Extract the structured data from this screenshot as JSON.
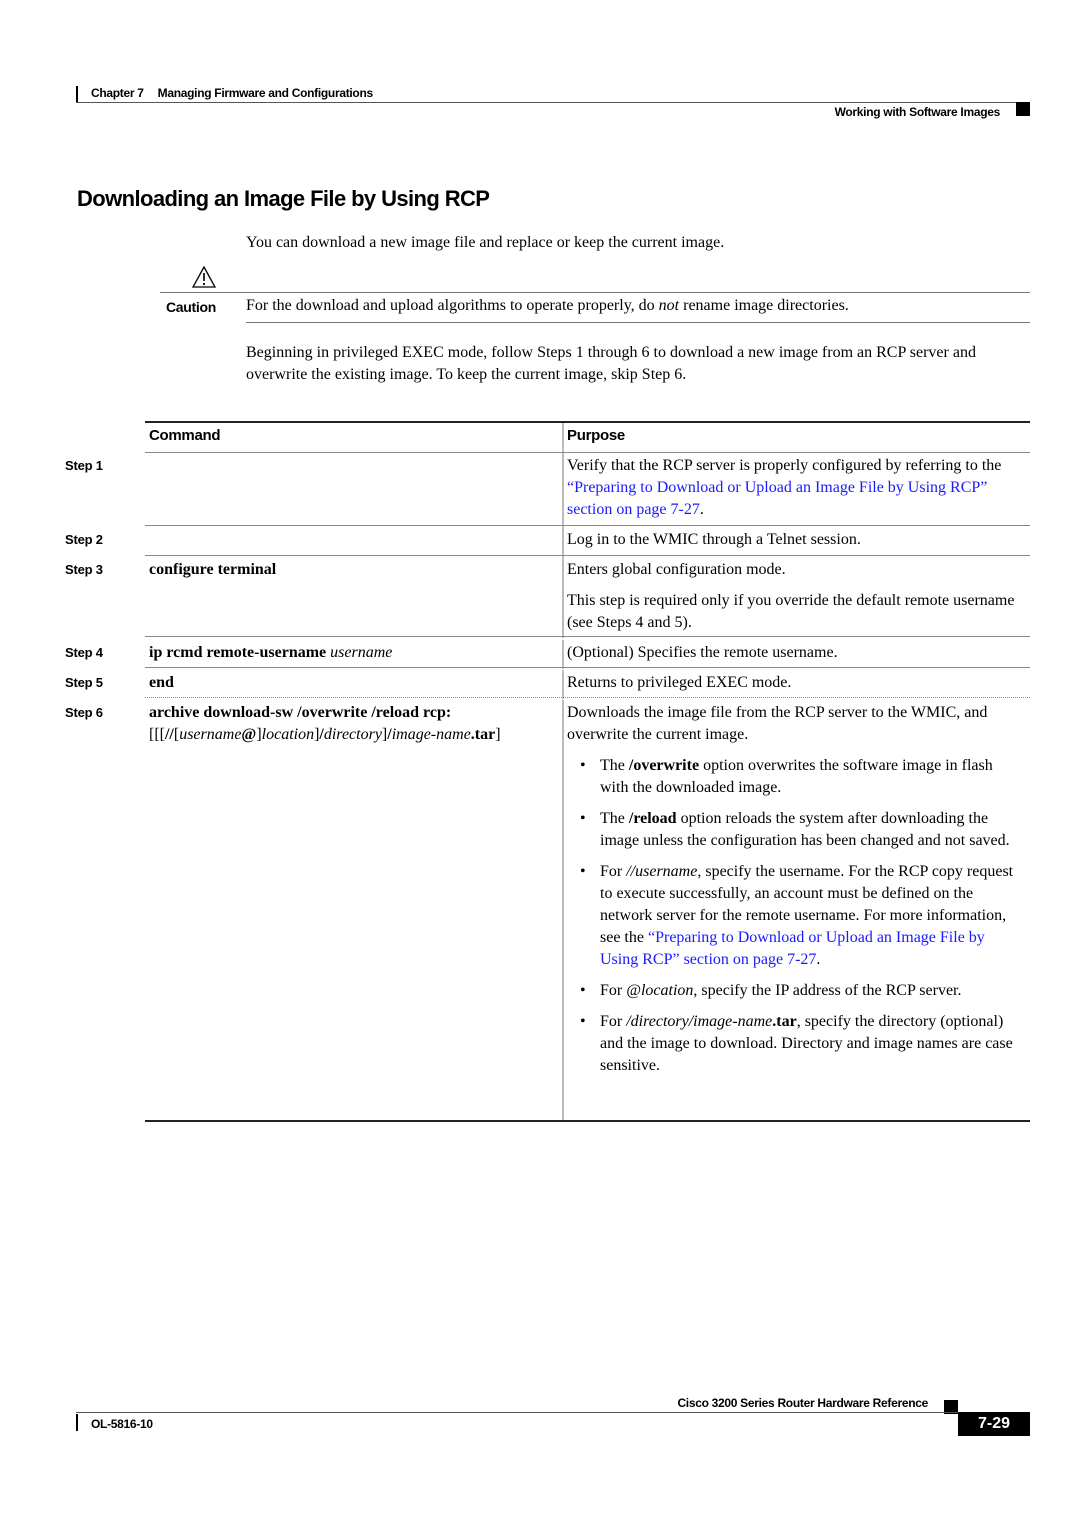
{
  "header": {
    "chapter_label": "Chapter 7",
    "chapter_title": "Managing Firmware and Configurations",
    "section_title": "Working with Software Images"
  },
  "page_title": "Downloading an Image File by Using RCP",
  "intro": "You can download a new image file and replace or keep the current image.",
  "caution": {
    "icon": "warning-triangle-icon",
    "label": "Caution",
    "text": [
      {
        "t": "For the download and upload algorithms to operate properly, do "
      },
      {
        "t": "not",
        "i": true
      },
      {
        "t": " rename image directories."
      }
    ]
  },
  "steps_intro": "Beginning in privileged EXEC mode, follow Steps 1 through 6 to download a new image from an RCP server and overwrite the existing image. To keep the current image, skip Step 6.",
  "table": {
    "columns": [
      "Command",
      "Purpose"
    ],
    "rows": [
      {
        "step": "Step 1",
        "command": [],
        "purpose": [
          {
            "type": "p",
            "runs": [
              {
                "t": "Verify that the RCP server is properly configured by referring to the "
              },
              {
                "t": "“Preparing to Download or Upload an Image File by Using RCP” section on page 7-27",
                "link": true
              },
              {
                "t": "."
              }
            ]
          }
        ]
      },
      {
        "step": "Step 2",
        "command": [],
        "purpose": [
          {
            "type": "p",
            "runs": [
              {
                "t": "Log in to the WMIC through a Telnet session."
              }
            ]
          }
        ]
      },
      {
        "step": "Step 3",
        "command": [
          {
            "t": "configure terminal",
            "b": true
          }
        ],
        "purpose": [
          {
            "type": "p",
            "runs": [
              {
                "t": "Enters global configuration mode."
              }
            ]
          },
          {
            "type": "p",
            "runs": [
              {
                "t": "This step is required only if you override the default remote username (see Steps 4 and 5)."
              }
            ]
          }
        ]
      },
      {
        "step": "Step 4",
        "command": [
          {
            "t": "ip rcmd remote-username ",
            "b": true
          },
          {
            "t": "username",
            "i": true
          }
        ],
        "purpose": [
          {
            "type": "p",
            "runs": [
              {
                "t": "(Optional) Specifies the remote username."
              }
            ]
          }
        ]
      },
      {
        "step": "Step 5",
        "command": [
          {
            "t": "end",
            "b": true
          }
        ],
        "purpose": [
          {
            "type": "p",
            "runs": [
              {
                "t": "Returns to privileged EXEC mode."
              }
            ]
          }
        ]
      },
      {
        "step": "Step 6",
        "command": [
          {
            "t": "archive download-sw /overwrite /reload",
            "b": true
          },
          {
            "t": " "
          },
          {
            "t": "rcp:",
            "b": true
          },
          {
            "t": "[[["
          },
          {
            "t": "//",
            "b": true
          },
          {
            "t": "["
          },
          {
            "t": "username",
            "i": true
          },
          {
            "t": "@",
            "b": true
          },
          {
            "t": "]"
          },
          {
            "t": "location",
            "i": true
          },
          {
            "t": "]"
          },
          {
            "t": "/",
            "b": true
          },
          {
            "t": "directory",
            "i": true
          },
          {
            "t": "]"
          },
          {
            "t": "/",
            "b": true
          },
          {
            "t": "image-name",
            "i": true
          },
          {
            "t": ".tar",
            "b": true
          },
          {
            "t": "]"
          }
        ],
        "purpose": [
          {
            "type": "p",
            "runs": [
              {
                "t": "Downloads the image file from the RCP server to the WMIC, and overwrite the current image."
              }
            ]
          },
          {
            "type": "ul",
            "items": [
              [
                {
                  "t": "The "
                },
                {
                  "t": "/overwrite",
                  "b": true
                },
                {
                  "t": " option overwrites the software image in flash with the downloaded image."
                }
              ],
              [
                {
                  "t": "The "
                },
                {
                  "t": "/reload",
                  "b": true
                },
                {
                  "t": " option reloads the system after downloading the image unless the configuration has been changed and not saved."
                }
              ],
              [
                {
                  "t": "For "
                },
                {
                  "t": "//username",
                  "i": true
                },
                {
                  "t": ", specify the username. For the RCP copy request to execute successfully, an account must be defined on the network server for the remote username. For more information, see the "
                },
                {
                  "t": "“Preparing to Download or Upload an Image File by Using RCP” section on page 7-27",
                  "link": true
                },
                {
                  "t": "."
                }
              ],
              [
                {
                  "t": "For "
                },
                {
                  "t": "@location",
                  "i": true
                },
                {
                  "t": ", specify the IP address of the RCP server."
                }
              ],
              [
                {
                  "t": "For "
                },
                {
                  "t": "/directory/image-name",
                  "i": true
                },
                {
                  "t": ".tar",
                  "b": true
                },
                {
                  "t": ", specify the directory (optional) and the image to download. Directory and image names are case sensitive."
                }
              ]
            ]
          }
        ]
      }
    ]
  },
  "footer": {
    "book_title": "Cisco 3200 Series Router Hardware Reference",
    "doc_number": "OL-5816-10",
    "page_number": "7-29"
  },
  "colors": {
    "link": "#1a1aff",
    "text": "#000000"
  }
}
